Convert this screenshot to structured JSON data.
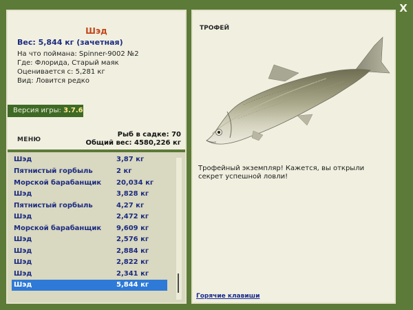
{
  "window": {
    "close_label": "X"
  },
  "fish": {
    "title": "Шэд",
    "weight_line": "Вес: 5,844 кг (зачетная)",
    "bait_line": "На что поймана: Spinner-9002 №2",
    "location_line": "Где: Флорида, Старый маяк",
    "value_line": "Оценивается с: 5,281 кг",
    "kind_line": "Вид: Ловится редко"
  },
  "version": {
    "label": "Версия игры:",
    "value": "3.7.6"
  },
  "menu": {
    "label": "МЕНЮ"
  },
  "stats": {
    "count_line": "Рыб в садке: 70",
    "total_line": "Общий вес: 4580,226 кг"
  },
  "catch_list": [
    {
      "name": "Шэд",
      "weight": "3,87 кг"
    },
    {
      "name": "Пятнистый горбыль",
      "weight": "2 кг"
    },
    {
      "name": "Морской барабанщик",
      "weight": "20,034 кг"
    },
    {
      "name": "Шэд",
      "weight": "3,828 кг"
    },
    {
      "name": "Пятнистый горбыль",
      "weight": "4,27 кг"
    },
    {
      "name": "Шэд",
      "weight": "2,472 кг"
    },
    {
      "name": "Морской барабанщик",
      "weight": "9,609 кг"
    },
    {
      "name": "Шэд",
      "weight": "2,576 кг"
    },
    {
      "name": "Шэд",
      "weight": "2,884 кг"
    },
    {
      "name": "Шэд",
      "weight": "2,822 кг"
    },
    {
      "name": "Шэд",
      "weight": "2,341 кг"
    },
    {
      "name": "Шэд",
      "weight": "5,844 кг",
      "selected": true
    }
  ],
  "trophy": {
    "label": "ТРОФЕЙ",
    "description": "Трофейный экземпляр! Кажется, вы открыли секрет успешной ловли!",
    "image_icon": "shad-fish-icon"
  },
  "links": {
    "hotkeys": "Горячие клавиши"
  },
  "colors": {
    "frame": "#5c7a38",
    "panel": "#f1f0e0",
    "list_bg": "#d9d8c0",
    "fish_title": "#c0461a",
    "list_text": "#1a2a80",
    "selected_row": "#2e7ad6",
    "version_bar": "#3e6a26"
  }
}
